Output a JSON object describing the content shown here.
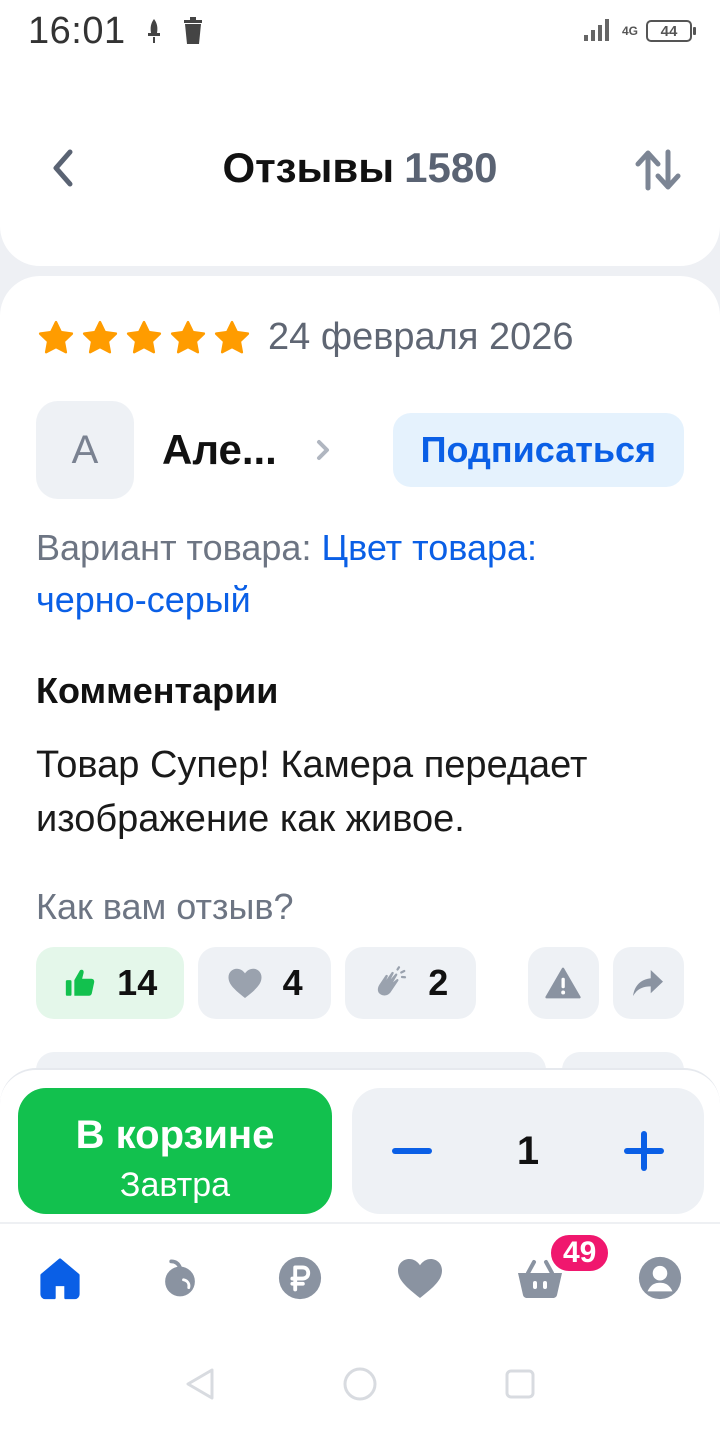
{
  "status_bar": {
    "time": "16:01",
    "network": "4G",
    "battery": "44"
  },
  "header": {
    "title": "Отзывы",
    "count": "1580",
    "back_icon": "chevron-left-icon",
    "sort_icon": "sort-arrows-icon"
  },
  "review": {
    "stars": 5,
    "date": "24 февраля 2026",
    "author": {
      "initial": "А",
      "name": "Але..."
    },
    "subscribe_label": "Подписаться",
    "variant_label": "Вариант товара:",
    "variant_value": "Цвет товара: черно-серый",
    "comments_title": "Комментарии",
    "comment_text": "Товар Супер! Камера передает изображение как живое.",
    "question": "Как вам отзыв?",
    "reactions": {
      "likes": "14",
      "hearts": "4",
      "claps": "2"
    }
  },
  "cart": {
    "in_cart_label": "В корзине",
    "delivery_label": "Завтра",
    "quantity": "1"
  },
  "tabbar": {
    "items": [
      "home-icon",
      "apple-icon",
      "ruble-icon",
      "heart-icon",
      "cart-icon",
      "profile-icon"
    ],
    "cart_badge": "49"
  },
  "colors": {
    "accent_blue": "#0a5fe6",
    "green": "#12c14e",
    "star": "#ff9c00",
    "badge": "#f0176e"
  }
}
